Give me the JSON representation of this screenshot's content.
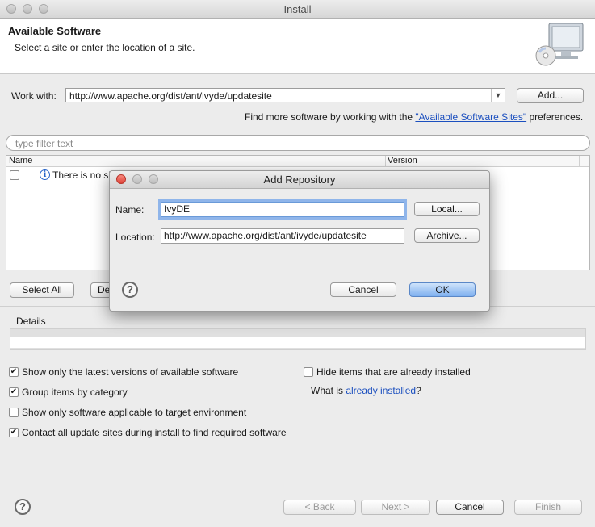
{
  "window": {
    "title": "Install"
  },
  "banner": {
    "heading": "Available Software",
    "subheading": "Select a site or enter the location of a site."
  },
  "work_with": {
    "label": "Work with:",
    "value": "http://www.apache.org/dist/ant/ivyde/updatesite",
    "add_button": "Add...",
    "find_more_prefix": "Find more software by working with the ",
    "find_more_link": "\"Available Software Sites\"",
    "find_more_suffix": " preferences."
  },
  "filter": {
    "placeholder": "type filter text"
  },
  "table": {
    "columns": [
      "Name",
      "Version"
    ],
    "rows": [
      {
        "text": "There is no si",
        "checked": false
      }
    ]
  },
  "selection_buttons": {
    "select_all": "Select All",
    "deselect_all_partial": "De"
  },
  "details": {
    "label": "Details"
  },
  "options": {
    "latest_versions": {
      "label": "Show only the latest versions of available software",
      "checked": true
    },
    "group_by_category": {
      "label": "Group items by category",
      "checked": true
    },
    "target_env": {
      "label": "Show only software applicable to target environment",
      "checked": false
    },
    "contact_sites": {
      "label": "Contact all update sites during install to find required software",
      "checked": true
    },
    "hide_installed": {
      "label": "Hide items that are already installed",
      "checked": false
    },
    "what_is_prefix": "What is ",
    "what_is_link": "already installed",
    "what_is_suffix": "?"
  },
  "footer": {
    "back": "< Back",
    "next": "Next >",
    "cancel": "Cancel",
    "finish": "Finish"
  },
  "dialog": {
    "title": "Add Repository",
    "name_label": "Name:",
    "name_value": "IvyDE",
    "location_label": "Location:",
    "location_value": "http://www.apache.org/dist/ant/ivyde/updatesite",
    "local_button": "Local...",
    "archive_button": "Archive...",
    "cancel_button": "Cancel",
    "ok_button": "OK"
  },
  "icons": {
    "monitor": "monitor-cd-icon",
    "info": "info-icon",
    "help": "help-icon",
    "dropdown": "chevron-down-icon"
  },
  "colors": {
    "link": "#1b4fbf",
    "default_button": "#7fb0ef"
  }
}
